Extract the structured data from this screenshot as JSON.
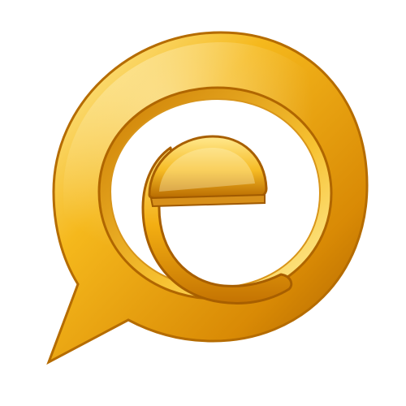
{
  "logo": {
    "icon": "gold-chat-bubble-e-icon",
    "colors": {
      "gold_light": "#fff2a8",
      "gold_mid": "#f5b81c",
      "gold_deep": "#d98a05",
      "gold_dark": "#a85f00",
      "background": "#ffffff"
    }
  }
}
